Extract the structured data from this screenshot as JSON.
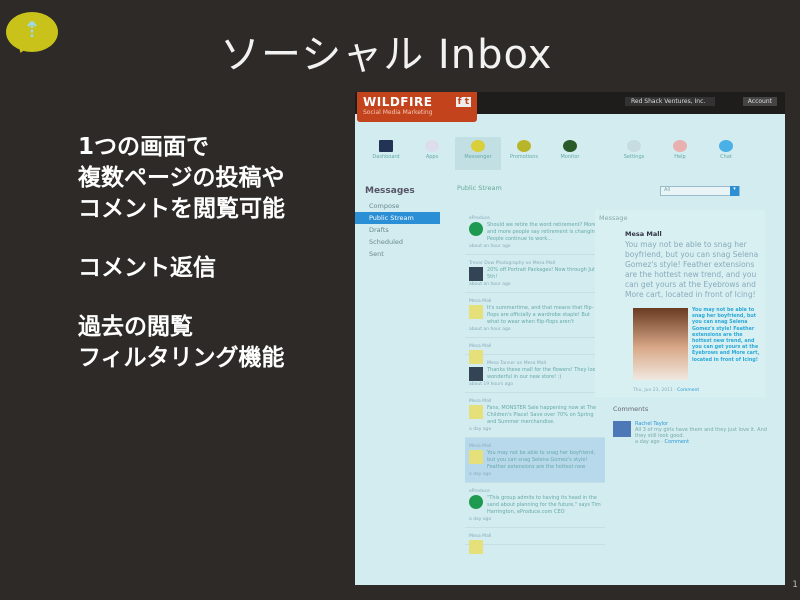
{
  "slide": {
    "title": "ソーシャル Inbox",
    "bullets": [
      [
        "1つの画面で",
        "複数ページの投稿や",
        "コメントを閲覧可能"
      ],
      [
        "コメント返信"
      ],
      [
        "過去の閲覧",
        "フィルタリング機能"
      ]
    ],
    "page_number": "1"
  },
  "app": {
    "brand": "WILDFIRE",
    "tagline": "Social Media Marketing",
    "social": "f t",
    "account_select": "Red Shack Ventures, Inc.",
    "account_button": "Account",
    "nav": [
      "Dashboard",
      "Apps",
      "Messenger",
      "Promotions",
      "Monitor",
      "Settings",
      "Help",
      "Chat"
    ],
    "sidebar": {
      "title": "Messages",
      "items": [
        "Compose",
        "Public Stream",
        "Drafts",
        "Scheduled",
        "Sent"
      ]
    },
    "stream": {
      "title": "Public Stream",
      "filter": "All",
      "posts": [
        {
          "who": "eProduce",
          "text": "Should we retire the word retirement? More and more people say retirement is changing. People continue to work...",
          "time": "about an hour ago"
        },
        {
          "who": "Trevor Dow Photography on Mesa Mall",
          "text": "20% off Portrait Packages! Now through July 5th!",
          "time": "about an hour ago"
        },
        {
          "who": "Mesa Mall",
          "text": "It's summertime, and that means that flip-flops are officially a wardrobe staple! But what to wear when flip-flops aren't",
          "time": "about an hour ago"
        },
        {
          "who": "Mesa Mall",
          "text": "",
          "time": ""
        },
        {
          "who": "Mesa Tanner on Mesa Mall",
          "text": "Thanks these mall for the flowers! They look wonderful in our new store! :)",
          "time": "about 19 hours ago"
        },
        {
          "who": "Mesa Mall",
          "text": "Fans, MONSTER Sale happening now at The Children's Place! Save over 70% on Spring and Summer merchandise.",
          "time": "a day ago"
        },
        {
          "who": "Mesa Mall",
          "text": "You may not be able to snag her boyfriend, but you can snag Selena Gomez's style! Feather extensions are the hottest new",
          "time": "a day ago"
        },
        {
          "who": "eProduce",
          "text": "\"This group admits to having its head in the sand about planning for the future,\" says Tim Harrington, eProduce.com CEO",
          "time": "a day ago"
        },
        {
          "who": "Mesa Mall",
          "text": "",
          "time": ""
        }
      ]
    },
    "message": {
      "title": "Message",
      "author": "Mesa Mall",
      "body": "You may not be able to snag her boyfriend, but you can snag Selena Gomez's style! Feather extensions are the hottest new trend, and you can get yours at the Eyebrows and More cart, located in front of Icing!",
      "caption": "You may not be able to snag her boyfriend, but you can snag Selena Gomez's style! Feather extensions are the hottest new trend, and you can get yours at the Eyebrows and More cart, located in front of Icing!",
      "meta": "Thu, Jun 23, 2011",
      "comment_link": "Comment"
    },
    "comments": {
      "title": "Comments",
      "items": [
        {
          "name": "Rachel Taylor",
          "text": "All 3 of my girls have them and they just love it. And they still look good.",
          "time": "a day ago",
          "link": "Comment"
        }
      ]
    }
  }
}
